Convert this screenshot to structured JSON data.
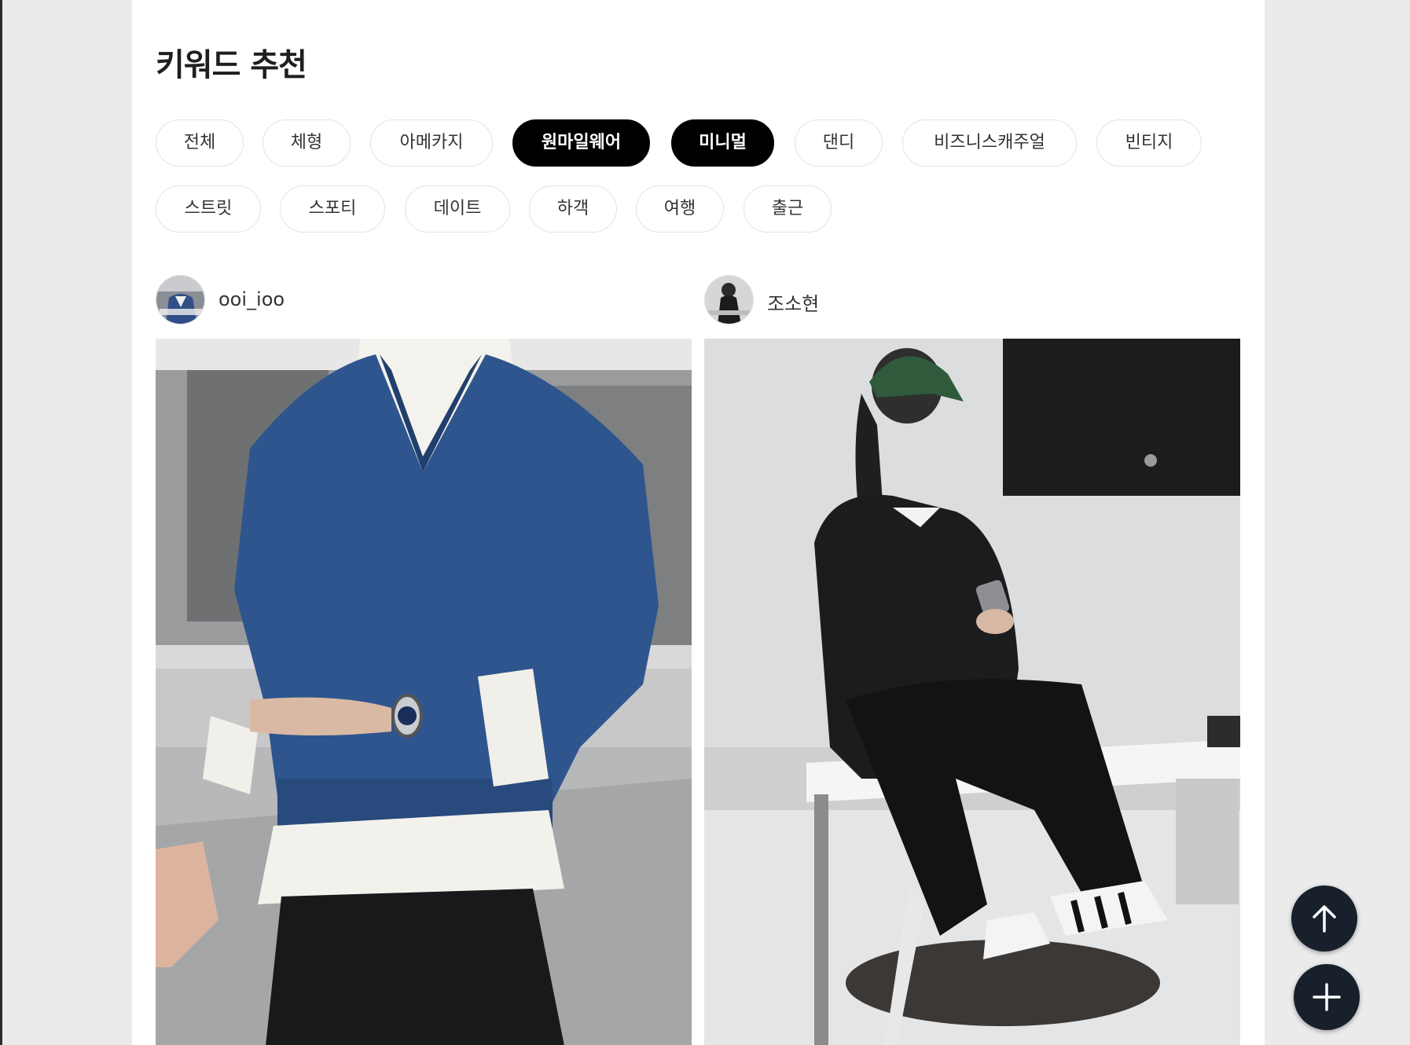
{
  "page": {
    "title": "키워드 추천"
  },
  "keywords": [
    {
      "label": "전체",
      "active": false
    },
    {
      "label": "체형",
      "active": false
    },
    {
      "label": "아메카지",
      "active": false
    },
    {
      "label": "원마일웨어",
      "active": true
    },
    {
      "label": "미니멀",
      "active": true
    },
    {
      "label": "댄디",
      "active": false
    },
    {
      "label": "비즈니스캐주얼",
      "active": false
    },
    {
      "label": "빈티지",
      "active": false
    },
    {
      "label": "스트릿",
      "active": false
    },
    {
      "label": "스포티",
      "active": false
    },
    {
      "label": "데이트",
      "active": false
    },
    {
      "label": "하객",
      "active": false
    },
    {
      "label": "여행",
      "active": false
    },
    {
      "label": "출근",
      "active": false
    }
  ],
  "posts": [
    {
      "username": "ooi_ioo",
      "avatar_icon": "user-avatar-photo",
      "photo": "man-blue-vneck-sweater-white-shirt"
    },
    {
      "username": "조소현",
      "avatar_icon": "user-avatar-photo",
      "photo": "woman-black-suit-green-cap-sitting-desk"
    }
  ],
  "actions": {
    "scroll_top_icon": "arrow-up-icon",
    "add_icon": "plus-icon"
  },
  "colors": {
    "active_chip": "#000000",
    "fab": "#17202b",
    "panel_bg": "#ffffff",
    "page_bg": "#ebebeb"
  }
}
